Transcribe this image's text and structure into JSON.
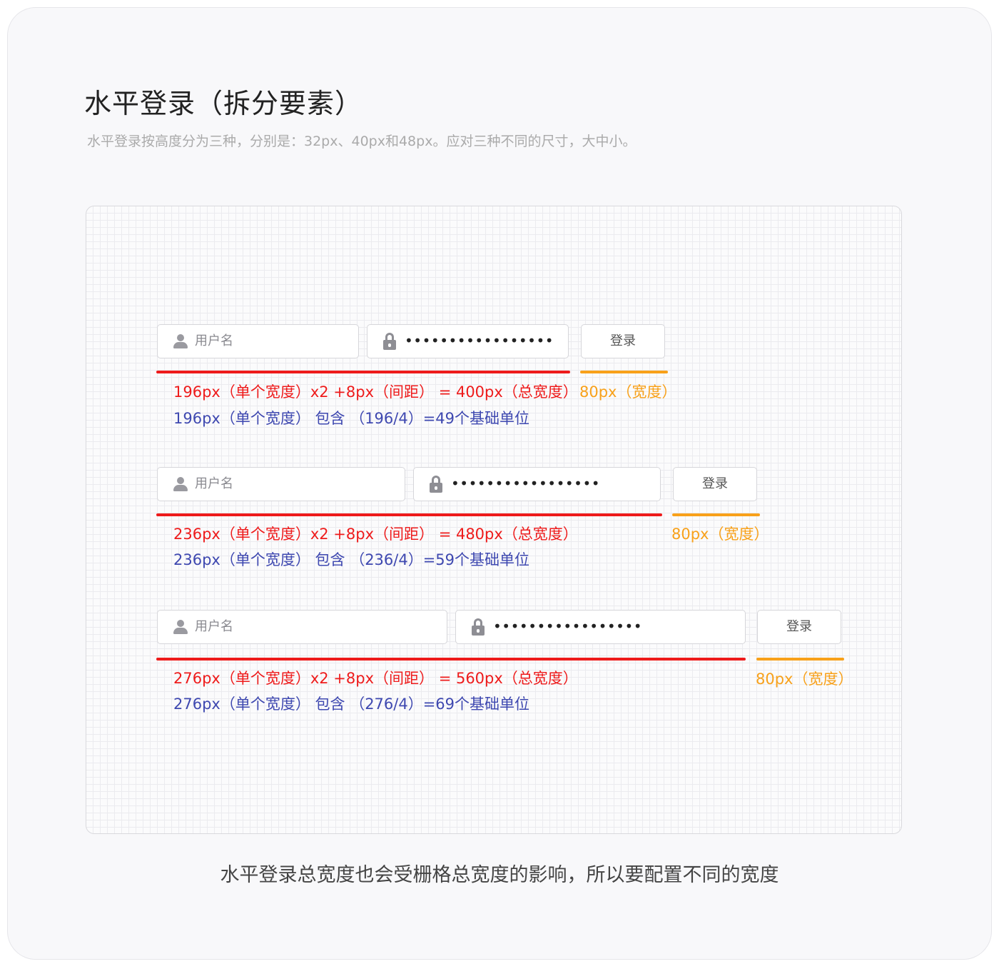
{
  "header": {
    "title": "水平登录（拆分要素）",
    "subtitle": "水平登录按高度分为三种，分别是：32px、40px和48px。应对三种不同的尺寸，大中小。"
  },
  "rows": [
    {
      "username_placeholder": "用户名",
      "password_mask": "•••••••••••••••••",
      "login_label": "登录",
      "total_note": "196px（单个宽度）x2 +8px（间距） = 400px（总宽度）",
      "button_note": "80px（宽度）",
      "unit_note": "196px（单个宽度） 包含 （196/4）=49个基础单位"
    },
    {
      "username_placeholder": "用户名",
      "password_mask": "•••••••••••••••••",
      "login_label": "登录",
      "total_note": "236px（单个宽度）x2 +8px（间距） = 480px（总宽度）",
      "button_note": "80px（宽度）",
      "unit_note": "236px（单个宽度） 包含 （236/4）=59个基础单位"
    },
    {
      "username_placeholder": "用户名",
      "password_mask": "•••••••••••••••••",
      "login_label": "登录",
      "total_note": "276px（单个宽度）x2 +8px（间距） = 560px（总宽度）",
      "button_note": "80px（宽度）",
      "unit_note": "276px（单个宽度） 包含 （276/4）=69个基础单位"
    }
  ],
  "footer": {
    "caption": "水平登录总宽度也会受栅格总宽度的影响，所以要配置不同的宽度"
  },
  "colors": {
    "width_line": "#ee1b1b",
    "button_line": "#f8a11a",
    "unit_text": "#3e48b0"
  },
  "icons": {
    "username": "user-icon",
    "password": "lock-icon"
  }
}
